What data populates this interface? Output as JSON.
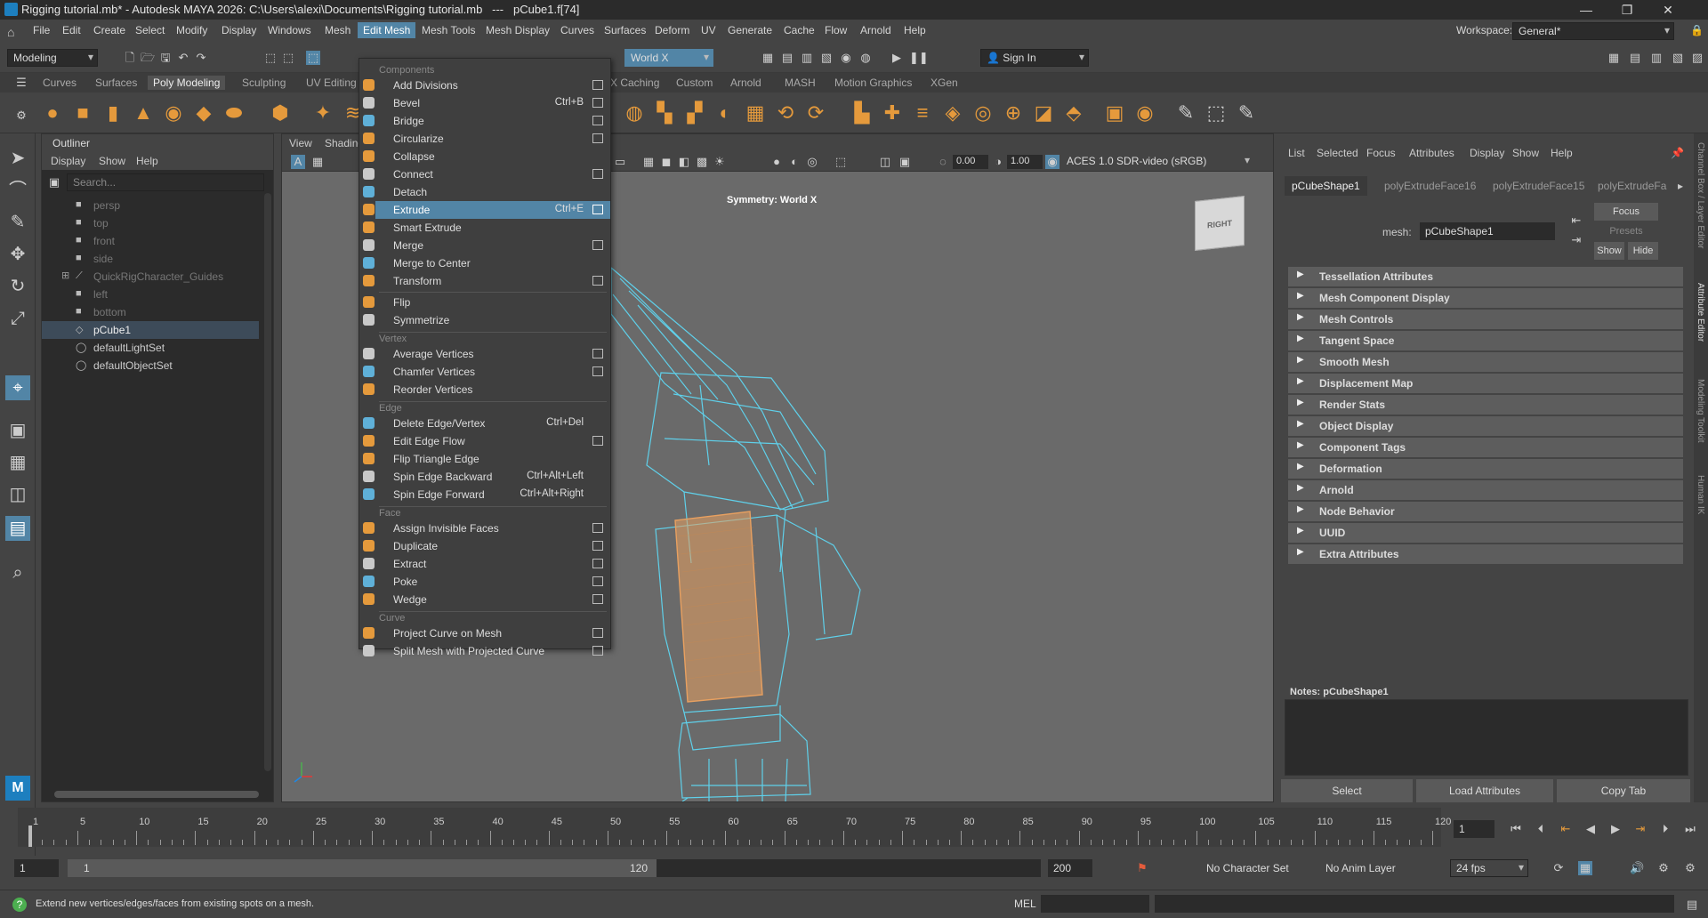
{
  "window": {
    "title": "Rigging tutorial.mb* - Autodesk MAYA 2026: C:\\Users\\alexi\\Documents\\Rigging tutorial.mb   ---   pCube1.f[74]",
    "minimize": "—",
    "restore": "❐",
    "close": "✕"
  },
  "menubar": {
    "items": [
      "File",
      "Edit",
      "Create",
      "Select",
      "Modify",
      "Display",
      "Windows",
      "Mesh",
      "Edit Mesh",
      "Mesh Tools",
      "Mesh Display",
      "Curves",
      "Surfaces",
      "Deform",
      "UV",
      "Generate",
      "Cache",
      "Flow",
      "Arnold",
      "Help"
    ],
    "active": "Edit Mesh",
    "workspace_label": "Workspace:",
    "workspace_value": "General*"
  },
  "statusline": {
    "mode": "Modeling",
    "symmetry": "World X",
    "sign_in": "Sign In"
  },
  "shelf": {
    "tabs": [
      "Curves",
      "Surfaces",
      "Poly Modeling",
      "Sculpting",
      "UV Editing",
      "FX Caching",
      "Custom",
      "Arnold",
      "MASH",
      "Motion Graphics",
      "XGen"
    ],
    "active": "Poly Modeling",
    "tab_fragment": "X Caching"
  },
  "outliner": {
    "title": "Outliner",
    "menu": [
      "Display",
      "Show",
      "Help"
    ],
    "search_placeholder": "Search...",
    "items": [
      {
        "label": "persp",
        "icon": "camera-icon",
        "dim": true
      },
      {
        "label": "top",
        "icon": "camera-icon",
        "dim": true
      },
      {
        "label": "front",
        "icon": "camera-icon",
        "dim": true
      },
      {
        "label": "side",
        "icon": "camera-icon",
        "dim": true
      },
      {
        "label": "QuickRigCharacter_Guides",
        "icon": "joint-icon",
        "dim": true
      },
      {
        "label": "left",
        "icon": "camera-icon",
        "dim": true
      },
      {
        "label": "bottom",
        "icon": "camera-icon",
        "dim": true
      },
      {
        "label": "pCube1",
        "icon": "mesh-icon",
        "dim": false,
        "selected": true
      },
      {
        "label": "defaultLightSet",
        "icon": "set-icon",
        "dim": false
      },
      {
        "label": "defaultObjectSet",
        "icon": "set-icon",
        "dim": false
      }
    ]
  },
  "viewport": {
    "menu": [
      "View",
      "Shading"
    ],
    "exposure": "0.00",
    "gamma": "1.00",
    "color_space": "ACES 1.0 SDR-video (sRGB)",
    "symmetry_label": "Symmetry: World X",
    "viewcube": "RIGHT"
  },
  "edit_mesh_menu": {
    "sections": [
      {
        "header": "Components",
        "items": [
          {
            "label": "Add Divisions",
            "shortcut": "",
            "option": true,
            "icon": "add-divisions-icon"
          },
          {
            "label": "Bevel",
            "shortcut": "Ctrl+B",
            "option": true,
            "icon": "bevel-icon"
          },
          {
            "label": "Bridge",
            "shortcut": "",
            "option": true,
            "icon": "bridge-icon"
          },
          {
            "label": "Circularize",
            "shortcut": "",
            "option": true,
            "icon": "circularize-icon"
          },
          {
            "label": "Collapse",
            "shortcut": "",
            "option": false,
            "icon": "collapse-icon"
          },
          {
            "label": "Connect",
            "shortcut": "",
            "option": true,
            "icon": "connect-icon"
          },
          {
            "label": "Detach",
            "shortcut": "",
            "option": false,
            "icon": "detach-icon"
          },
          {
            "label": "Extrude",
            "shortcut": "Ctrl+E",
            "option": true,
            "icon": "extrude-icon",
            "highlighted": true
          },
          {
            "label": "Smart Extrude",
            "shortcut": "",
            "option": false,
            "icon": "smart-extrude-icon"
          },
          {
            "label": "Merge",
            "shortcut": "",
            "option": true,
            "icon": "merge-icon"
          },
          {
            "label": "Merge to Center",
            "shortcut": "",
            "option": false,
            "icon": "merge-center-icon"
          },
          {
            "label": "Transform",
            "shortcut": "",
            "option": true,
            "icon": "transform-icon"
          },
          {
            "label": "Flip",
            "shortcut": "",
            "option": false,
            "icon": "flip-icon",
            "sep_before": true
          },
          {
            "label": "Symmetrize",
            "shortcut": "",
            "option": false,
            "icon": "symmetrize-icon"
          }
        ]
      },
      {
        "header": "Vertex",
        "items": [
          {
            "label": "Average Vertices",
            "shortcut": "",
            "option": true,
            "icon": "average-vertices-icon"
          },
          {
            "label": "Chamfer Vertices",
            "shortcut": "",
            "option": true,
            "icon": "chamfer-vertices-icon"
          },
          {
            "label": "Reorder Vertices",
            "shortcut": "",
            "option": false,
            "icon": "reorder-vertices-icon"
          }
        ]
      },
      {
        "header": "Edge",
        "items": [
          {
            "label": "Delete Edge/Vertex",
            "shortcut": "Ctrl+Del",
            "option": false,
            "icon": "delete-edge-icon"
          },
          {
            "label": "Edit Edge Flow",
            "shortcut": "",
            "option": true,
            "icon": "edge-flow-icon"
          },
          {
            "label": "Flip Triangle Edge",
            "shortcut": "",
            "option": false,
            "icon": "flip-triangle-icon"
          },
          {
            "label": "Spin Edge Backward",
            "shortcut": "Ctrl+Alt+Left",
            "option": false,
            "icon": "spin-back-icon"
          },
          {
            "label": "Spin Edge Forward",
            "shortcut": "Ctrl+Alt+Right",
            "option": false,
            "icon": "spin-forward-icon"
          }
        ]
      },
      {
        "header": "Face",
        "items": [
          {
            "label": "Assign Invisible Faces",
            "shortcut": "",
            "option": true,
            "icon": "invisible-faces-icon"
          },
          {
            "label": "Duplicate",
            "shortcut": "",
            "option": true,
            "icon": "duplicate-icon"
          },
          {
            "label": "Extract",
            "shortcut": "",
            "option": true,
            "icon": "extract-icon"
          },
          {
            "label": "Poke",
            "shortcut": "",
            "option": true,
            "icon": "poke-icon"
          },
          {
            "label": "Wedge",
            "shortcut": "",
            "option": true,
            "icon": "wedge-icon"
          }
        ]
      },
      {
        "header": "Curve",
        "items": [
          {
            "label": "Project Curve on Mesh",
            "shortcut": "",
            "option": true,
            "icon": "project-curve-icon"
          },
          {
            "label": "Split Mesh with Projected Curve",
            "shortcut": "",
            "option": true,
            "icon": "split-mesh-icon"
          }
        ]
      }
    ]
  },
  "attribute_editor": {
    "menu": [
      "List",
      "Selected",
      "Focus",
      "Attributes",
      "Display",
      "Show",
      "Help"
    ],
    "tabs": [
      "pCubeShape1",
      "polyExtrudeFace16",
      "polyExtrudeFace15",
      "polyExtrudeFa"
    ],
    "active_tab": "pCubeShape1",
    "mesh_label": "mesh:",
    "mesh_value": "pCubeShape1",
    "focus": "Focus",
    "presets": "Presets",
    "show": "Show",
    "hide": "Hide",
    "sections": [
      "Tessellation Attributes",
      "Mesh Component Display",
      "Mesh Controls",
      "Tangent Space",
      "Smooth Mesh",
      "Displacement Map",
      "Render Stats",
      "Object Display",
      "Component Tags",
      "Deformation",
      "Arnold",
      "Node Behavior",
      "UUID",
      "Extra Attributes"
    ],
    "notes_label": "Notes:  pCubeShape1",
    "buttons": [
      "Select",
      "Load Attributes",
      "Copy Tab"
    ]
  },
  "side_tabs": [
    "Channel Box / Layer Editor",
    "Attribute Editor",
    "Modeling Toolkit",
    "Human IK"
  ],
  "timeline": {
    "ticks": [
      1,
      5,
      10,
      15,
      20,
      25,
      30,
      35,
      40,
      45,
      50,
      55,
      60,
      65,
      70,
      75,
      80,
      85,
      90,
      95,
      100,
      105,
      110,
      115,
      120
    ],
    "current_frame": "1",
    "range_start": "1",
    "range_inner_start": "1",
    "range_inner_end": "120",
    "range_end": "200",
    "character_set": "No Character Set",
    "anim_layer": "No Anim Layer",
    "fps": "24 fps"
  },
  "statusbar": {
    "help_text": "Extend new vertices/edges/faces from existing spots on a mesh.",
    "command_lang": "MEL"
  },
  "colors": {
    "accent": "#5285a6",
    "wireframe": "#5fd0ea",
    "selected_face": "#e8a060"
  }
}
